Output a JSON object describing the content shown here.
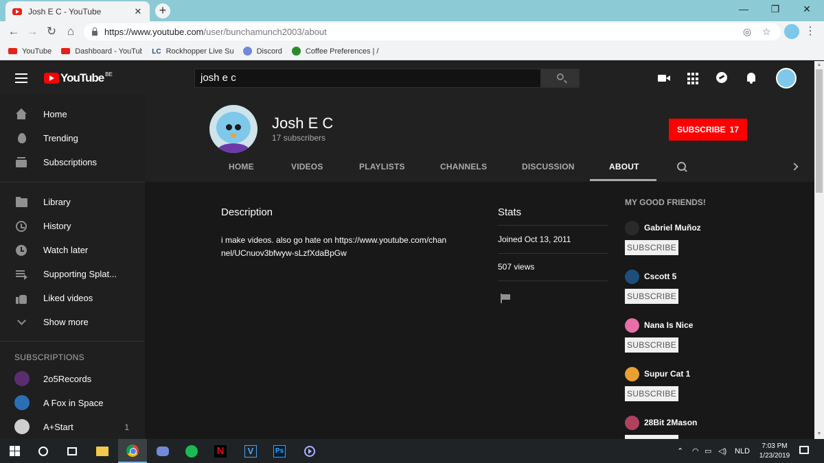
{
  "browser": {
    "tab_title": "Josh E C - YouTube",
    "tab_close": "✕",
    "new_tab": "+",
    "url_host": "https://www.youtube.com",
    "url_path": "/user/bunchamunch2003/about",
    "window_minimize": "—",
    "window_restore": "❐",
    "window_close": "✕",
    "back": "←",
    "forward": "→",
    "reload": "↻",
    "home": "⌂",
    "menu": "⋮",
    "star": "☆"
  },
  "bookmarks": [
    {
      "label": "YouTube",
      "icon": "youtube-icon"
    },
    {
      "label": "Dashboard - YouTube",
      "icon": "youtube-icon"
    },
    {
      "label": "Rockhopper Live Sub",
      "icon": "lc-icon",
      "icon_text": "LC"
    },
    {
      "label": "Discord",
      "icon": "discord-icon"
    },
    {
      "label": "Coffee Preferences | /",
      "icon": "clover-icon"
    }
  ],
  "header": {
    "logo_text": "YouTube",
    "logo_region": "BE",
    "search_query": "josh e c"
  },
  "sidebar": {
    "main": [
      {
        "label": "Home",
        "icon": "home-icon"
      },
      {
        "label": "Trending",
        "icon": "fire-icon"
      },
      {
        "label": "Subscriptions",
        "icon": "subscriptions-icon"
      }
    ],
    "library": [
      {
        "label": "Library",
        "icon": "folder-icon"
      },
      {
        "label": "History",
        "icon": "history-icon"
      },
      {
        "label": "Watch later",
        "icon": "clock-icon"
      },
      {
        "label": "Supporting Splat...",
        "icon": "playlist-icon"
      },
      {
        "label": "Liked videos",
        "icon": "like-icon"
      },
      {
        "label": "Show more",
        "icon": "chevron-down-icon"
      }
    ],
    "subscriptions_heading": "SUBSCRIPTIONS",
    "subscriptions": [
      {
        "label": "2o5Records",
        "color": "#5a2d6e",
        "count": ""
      },
      {
        "label": "A Fox in Space",
        "color": "#2a6fb5",
        "count": ""
      },
      {
        "label": "A+Start",
        "color": "#cfcfcf",
        "count": "1"
      }
    ]
  },
  "channel": {
    "name": "Josh E C",
    "subscribers": "17 subscribers",
    "subscribe_label": "SUBSCRIBE",
    "subscribe_count": "17",
    "tabs": [
      "HOME",
      "VIDEOS",
      "PLAYLISTS",
      "CHANNELS",
      "DISCUSSION",
      "ABOUT"
    ],
    "active_tab": "ABOUT"
  },
  "about": {
    "description_title": "Description",
    "description": "i make videos. also go hate on https://www.youtube.com/channel/UCnuov3bfwyw-sLzfXdaBpGw",
    "stats_title": "Stats",
    "joined": "Joined Oct 13, 2011",
    "views": "507 views"
  },
  "friends": {
    "title": "MY GOOD FRIENDS!",
    "subscribe_label": "SUBSCRIBE",
    "items": [
      {
        "name": "Gabriel Muñoz",
        "color": "#2a2a2a"
      },
      {
        "name": "Cscott 5",
        "color": "#1e4f7a"
      },
      {
        "name": "Nana Is Nice",
        "color": "#e86fa8"
      },
      {
        "name": "Supur Cat 1",
        "color": "#e8a030"
      },
      {
        "name": "28Bit 2Mason",
        "color": "#b04060"
      }
    ]
  },
  "taskbar": {
    "language": "NLD",
    "time": "7:03 PM",
    "date": "1/23/2019",
    "netflix_letter": "N",
    "v_letter": "V",
    "ps_letter": "Ps"
  },
  "colors": {
    "accent_red": "#ff0000",
    "page_bg": "#181818",
    "header_bg": "#212121"
  }
}
